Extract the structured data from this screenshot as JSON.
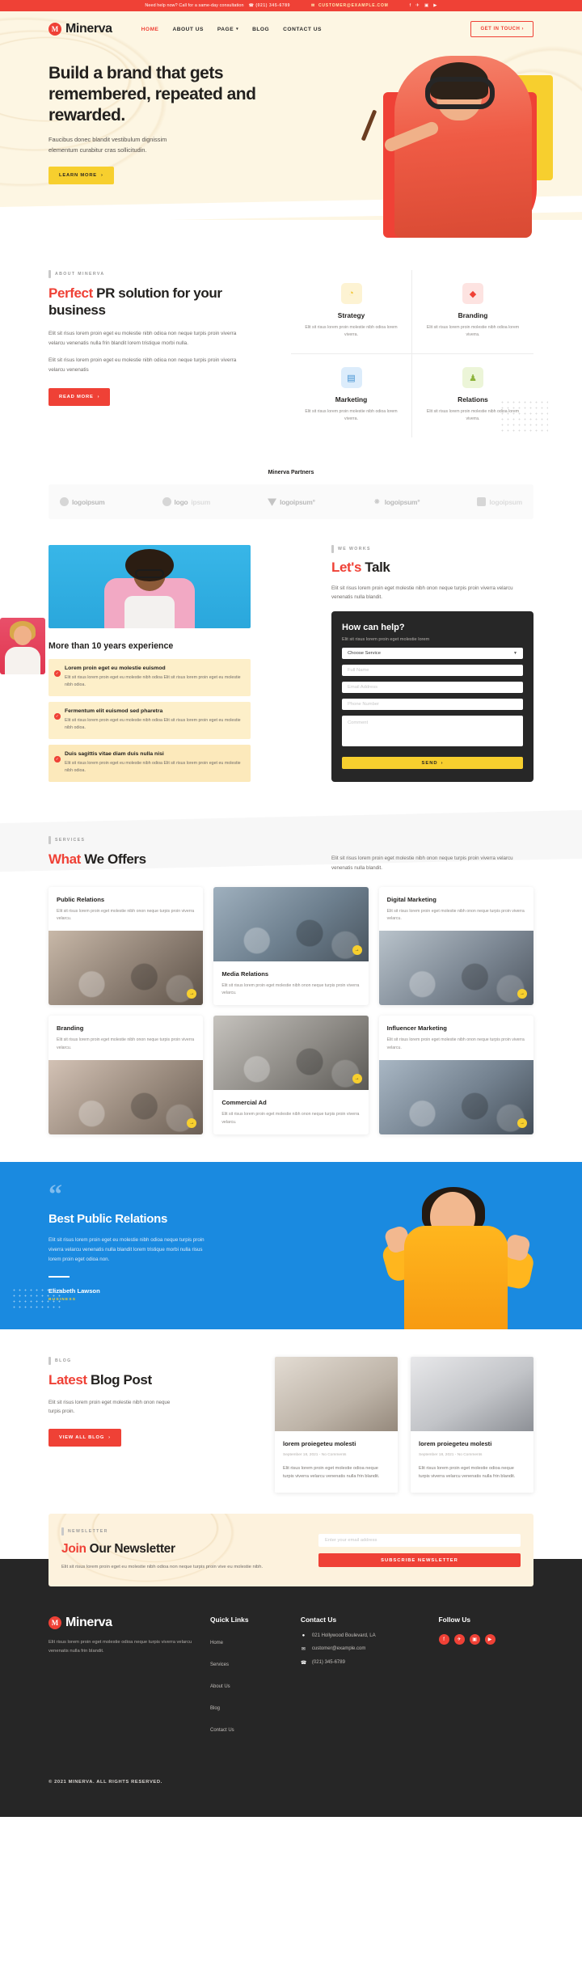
{
  "topbar": {
    "help_text": "Need help now? Call for a same-day consultation",
    "phone": "(021) 345-6789",
    "phone_icon": "phone-icon",
    "email": "CUSTOMER@EXAMPLE.COM",
    "email_icon": "mail-icon",
    "social": [
      {
        "name": "facebook-icon",
        "glyph": "f"
      },
      {
        "name": "twitter-icon",
        "glyph": "✈"
      },
      {
        "name": "instagram-icon",
        "glyph": "▣"
      },
      {
        "name": "youtube-icon",
        "glyph": "▶"
      }
    ]
  },
  "nav": {
    "brand_mark": "M",
    "brand_name": "Minerva",
    "links": [
      {
        "label": "HOME",
        "active": true
      },
      {
        "label": "ABOUT US",
        "active": false
      },
      {
        "label": "PAGE",
        "active": false,
        "caret": "▾"
      },
      {
        "label": "BLOG",
        "active": false
      },
      {
        "label": "CONTACT US",
        "active": false
      }
    ],
    "cta": "GET IN TOUCH"
  },
  "hero": {
    "title": "Build a brand that gets remembered, repeated and rewarded.",
    "subtitle": "Faucibus donec blandit vestibulum dignissim elementum curabitur cras sollicitudin.",
    "button": "LEARN MORE"
  },
  "about": {
    "label": "ABOUT MINERVA",
    "title_accent": "Perfect",
    "title_rest": " PR solution for your business",
    "paragraph1": "Elit sit risus lorem proin eget eu molestie nibh odioa non neque turpis proin viverra velarcu venenatis nulla frin blandit lorem tristique morbi nulla.",
    "paragraph2": "Elit sit risus lorem proin eget eu molestie nibh odioa non neque turpis proin viverra velarcu venenatis",
    "button": "READ MORE",
    "features": [
      {
        "icon": "pie-chart-icon",
        "glyph": "◔",
        "title": "Strategy",
        "text": "Elit sit risus lorem proin molestie nibh odioa lorem viverra.",
        "bg": "#fdf3d3",
        "fg": "#f0c32c"
      },
      {
        "icon": "diamond-icon",
        "glyph": "◆",
        "title": "Branding",
        "text": "Elit sit risus lorem proin molestie nibh odioa lorem viverra.",
        "bg": "#fde3e1",
        "fg": "#ef4136"
      },
      {
        "icon": "bar-chart-icon",
        "glyph": "▤",
        "title": "Marketing",
        "text": "Elit sit risus lorem proin molestie nibh odioa lorem viverra.",
        "bg": "#dcecfb",
        "fg": "#3e8ed0"
      },
      {
        "icon": "people-icon",
        "glyph": "♟",
        "title": "Relations",
        "text": "Elit sit risus lorem proin molestie nibh odioa lorem viverra.",
        "bg": "#ecf5d8",
        "fg": "#8db33b"
      }
    ]
  },
  "partners": {
    "heading": "Minerva Partners",
    "logos": [
      {
        "name": "logoipsum-1",
        "label": "logoipsum",
        "mark": "circle"
      },
      {
        "name": "logoipsum-2",
        "label": "logo",
        "label_faded": "ipsum",
        "mark": "circle"
      },
      {
        "name": "logoipsum-3",
        "label": "logoipsum°",
        "mark": "triangle"
      },
      {
        "name": "logoipsum-4",
        "label": "logoipsum°",
        "mark": "dots"
      },
      {
        "name": "logoipsum-5",
        "label": "logoipsum",
        "mark": "square"
      }
    ]
  },
  "works": {
    "label": "WE WORKS",
    "title_accent": "Let's",
    "title_rest": " Talk",
    "paragraph": "Elit sit risus lorem proin eget molestie nibh onon neque turpis proin viverra velarcu venenatis nulla blandit.",
    "experience_title": "More than 10 years experience",
    "items": [
      {
        "title": "Lorem proin eget eu molestie euismod",
        "text": "Elit sit risus lorem proin eget eu molestie nibh odioa Elit sit risus lorem proin eget eu molestie nibh odioa."
      },
      {
        "title": "Fermentum elit euismod sed pharetra",
        "text": "Elit sit risus lorem proin eget eu molestie nibh odioa Elit sit risus lorem proin eget eu molestie nibh odioa."
      },
      {
        "title": "Duis sagittis vitae diam duis nulla nisi",
        "text": "Elit sit risus lorem proin eget eu molestie nibh odioa Elit sit risus lorem proin eget eu molestie nibh odioa."
      }
    ],
    "form": {
      "heading": "How can help?",
      "subheading": "Elit sit risus lorem proin eget molestie lorem",
      "service_value": "Choose Service",
      "name_placeholder": "Full Name",
      "email_placeholder": "Email Address",
      "phone_placeholder": "Phone Number",
      "comment_placeholder": "Comment",
      "submit": "SEND"
    }
  },
  "services": {
    "label": "SERVICES",
    "title_accent": "What",
    "title_rest": " We Offers",
    "description": "Elit sit risus lorem proin eget molestie nibh onon neque turpis proin viverra velarcu venenatis nulla blandit.",
    "cards": [
      {
        "title": "Public Relations",
        "desc": "Elit sit risus lorem proin eget molestie nibh onon neque turpis proin viverra velarcu.",
        "arrow": "→"
      },
      {
        "title": "Media Relations",
        "desc": "Elit sit risus lorem proin eget molestie nibh onon neque turpis proin viverra velarcu.",
        "arrow": "→"
      },
      {
        "title": "Digital Marketing",
        "desc": "Elit sit risus lorem proin eget molestie nibh onon neque turpis proin viverra velarcu.",
        "arrow": "→"
      },
      {
        "title": "Branding",
        "desc": "Elit sit risus lorem proin eget molestie nibh onon neque turpis proin viverra velarcu.",
        "arrow": "→"
      },
      {
        "title": "Commercial Ad",
        "desc": "Elit sit risus lorem proin eget molestie nibh onon neque turpis proin viverra velarcu.",
        "arrow": "→"
      },
      {
        "title": "Influencer Marketing",
        "desc": "Elit sit risus lorem proin eget molestie nibh onon neque turpis proin viverra velarcu.",
        "arrow": "→"
      }
    ]
  },
  "testimonial": {
    "quote_mark": "“",
    "heading": "Best Public Relations",
    "text": "Elit sit risus lorem proin eget eu molestie nibh odioa neque turpis proin viverra velarcu venenatis nulla blandit lorem tristique morbi nulla risus lorem proin eget odioa non.",
    "author": "Elizabeth Lawson",
    "role": "BUSINESS"
  },
  "blog": {
    "label": "BLOG",
    "title_accent": "Latest",
    "title_rest": " Blog Post",
    "paragraph": "Elit sit risus lorem proin eget molestie nibh onon neque turpis proin.",
    "button": "VIEW ALL BLOG",
    "posts": [
      {
        "title": "lorem proiegeteu molesti",
        "meta": "September 18, 2021 - No Comments",
        "text": "Elit risus lorem proin eget molestie odioa neque turpis viverra velarcu venenatis nulla frin blandit."
      },
      {
        "title": "lorem proiegeteu molesti",
        "meta": "September 18, 2021 - No Comments",
        "text": "Elit risus lorem proin eget molestie odioa neque turpis viverra velarcu venenatis nulla frin blandit."
      }
    ]
  },
  "newsletter": {
    "label": "NEWSLETTER",
    "title_accent": "Join",
    "title_rest": " Our Newsletter",
    "paragraph": "Elit sit risus lorem proin eget eu molestie nibh odioa non neque turpis proin vive eu molestie nibh.",
    "input_placeholder": "Enter your email address",
    "button": "SUBSCRIBE NEWSLETTER"
  },
  "footer": {
    "brand_mark": "M",
    "brand_name": "Minerva",
    "about": "Elit risus lorem proin eget molestie odioa neque turpis viverra velarcu venenatis nulla frin blandit.",
    "quick_links_heading": "Quick Links",
    "quick_links": [
      "Home",
      "Services",
      "About Us",
      "Blog",
      "Contact Us"
    ],
    "contact_heading": "Contact Us",
    "contact": [
      {
        "icon": "location-icon",
        "glyph": "◉",
        "value": "021 Hollywood Boulevard, LA"
      },
      {
        "icon": "mail-icon",
        "glyph": "✉",
        "value": "customer@example.com"
      },
      {
        "icon": "phone-icon",
        "glyph": "✆",
        "value": "(021) 345-6789"
      }
    ],
    "follow_heading": "Follow Us",
    "social": [
      {
        "name": "facebook-icon",
        "glyph": "f"
      },
      {
        "name": "twitter-icon",
        "glyph": "✈"
      },
      {
        "name": "instagram-icon",
        "glyph": "▣"
      },
      {
        "name": "youtube-icon",
        "glyph": "▶"
      }
    ],
    "copyright": "© 2021 MINERVA. ALL RIGHTS RESERVED."
  }
}
